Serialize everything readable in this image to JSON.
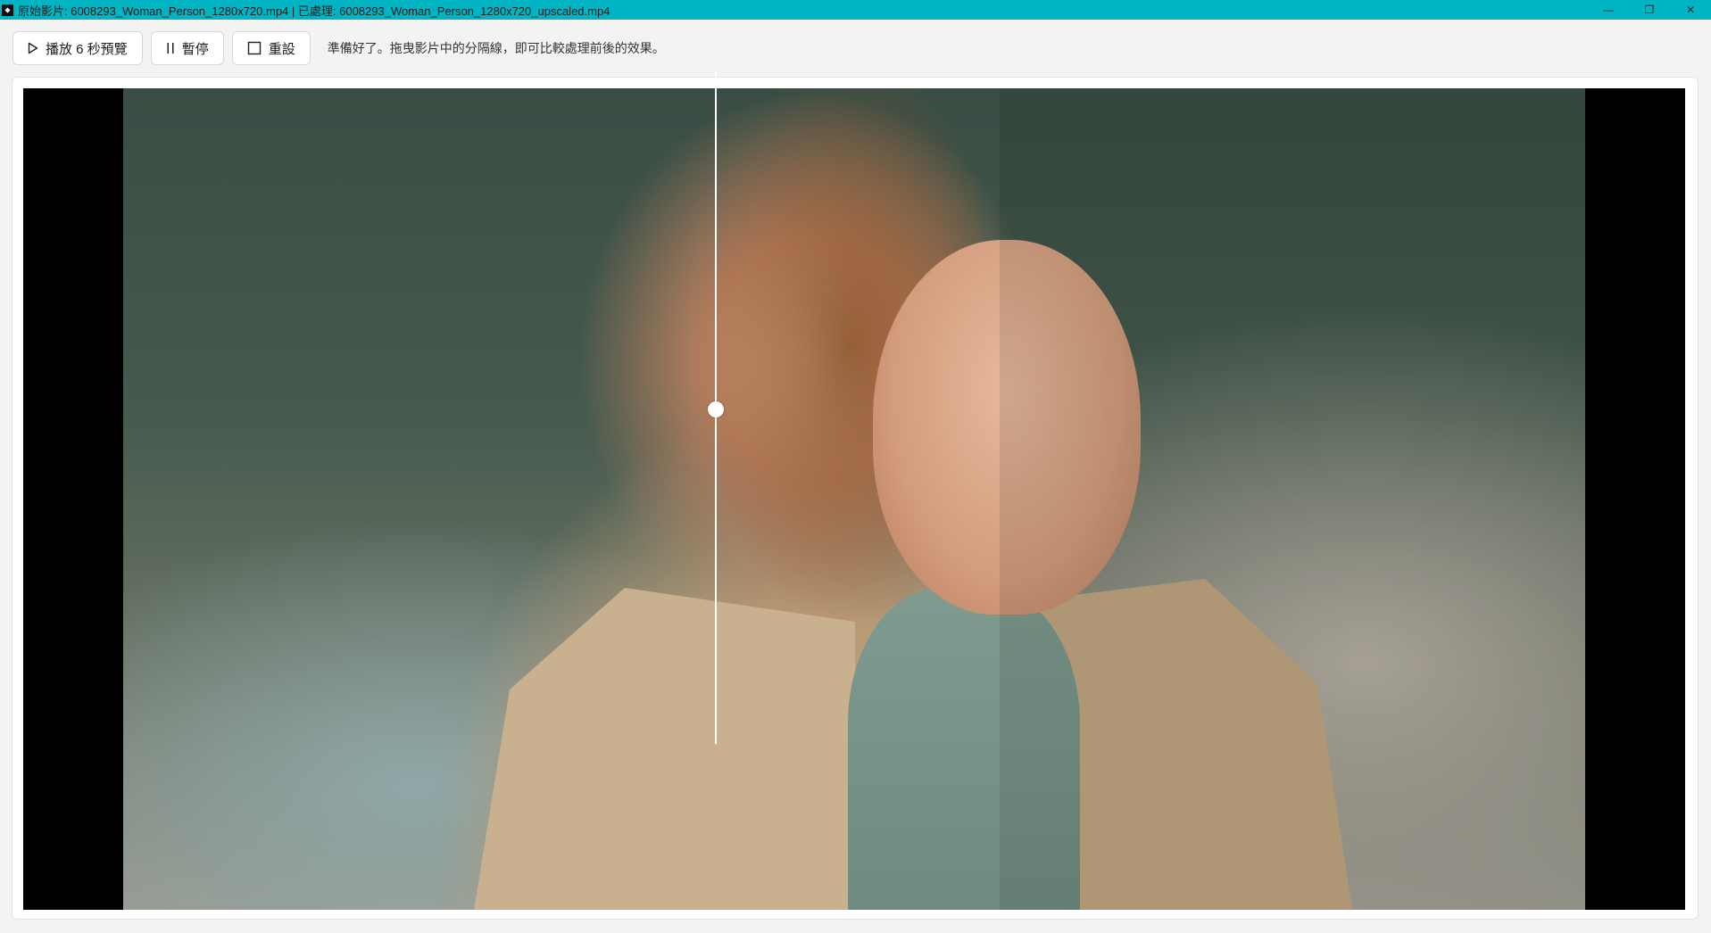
{
  "window": {
    "title": "原始影片: 6008293_Woman_Person_1280x720.mp4 | 已處理: 6008293_Woman_Person_1280x720_upscaled.mp4",
    "min_glyph": "—",
    "max_glyph": "❐",
    "close_glyph": "✕"
  },
  "toolbar": {
    "play_label": "播放 6 秒預覽",
    "pause_label": "暫停",
    "reset_label": "重設",
    "status": "準備好了。拖曳影片中的分隔線，即可比較處理前後的效果。"
  },
  "colors": {
    "titlebar": "#00b4c4",
    "background": "#f3f3f3",
    "divider": "#ffffff"
  },
  "icons": [
    "play-icon",
    "pause-icon",
    "reset-icon",
    "app-icon"
  ]
}
